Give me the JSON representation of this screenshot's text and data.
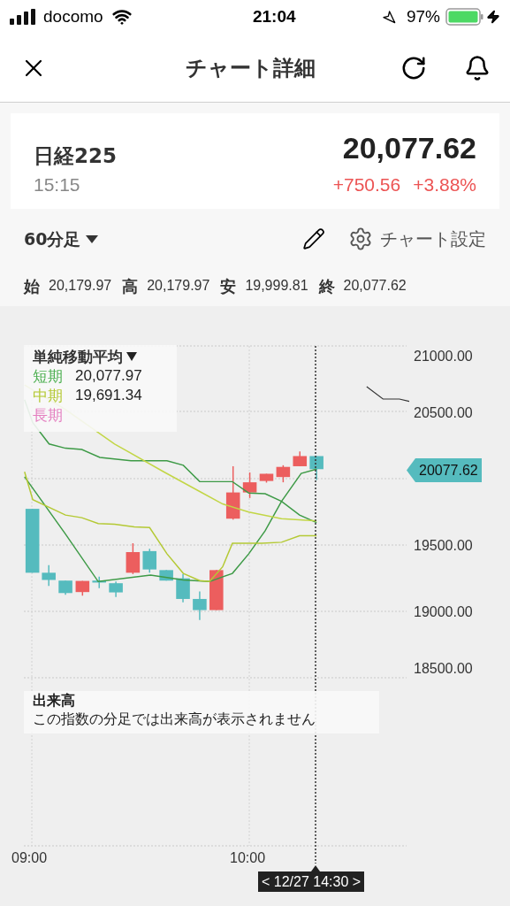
{
  "status_bar": {
    "carrier": "docomo",
    "time": "21:04",
    "battery": "97%"
  },
  "header": {
    "title": "チャート詳細"
  },
  "quote": {
    "name": "日経225",
    "price": "20,077.62",
    "time": "15:15",
    "change": "+750.56",
    "change_pct": "+3.88%"
  },
  "toolbar": {
    "interval": "60分足",
    "settings": "チャート設定"
  },
  "ohlc": [
    {
      "label": "始",
      "value": "20,179.97"
    },
    {
      "label": "高",
      "value": "20,179.97"
    },
    {
      "label": "安",
      "value": "19,999.81"
    },
    {
      "label": "終",
      "value": "20,077.62"
    }
  ],
  "chart": {
    "legend": {
      "title": "単純移動平均",
      "items": [
        {
          "label": "短期",
          "value": "20,077.97",
          "color": "#4caf50"
        },
        {
          "label": "中期",
          "value": "19,691.34",
          "color": "#b4c934"
        },
        {
          "label": "長期",
          "color": "#e47fc0"
        }
      ]
    },
    "y_labels": [
      "21000.00",
      "20500.00",
      "19500.00",
      "19000.00",
      "18500.00"
    ],
    "price_tag": "20077.62",
    "x_labels": [
      "09:00",
      "10:00"
    ],
    "cursor_label": "< 12/27 14:30 >"
  },
  "volume": {
    "title": "出来高",
    "message": "この指数の分足では出来高が表示されません"
  }
}
